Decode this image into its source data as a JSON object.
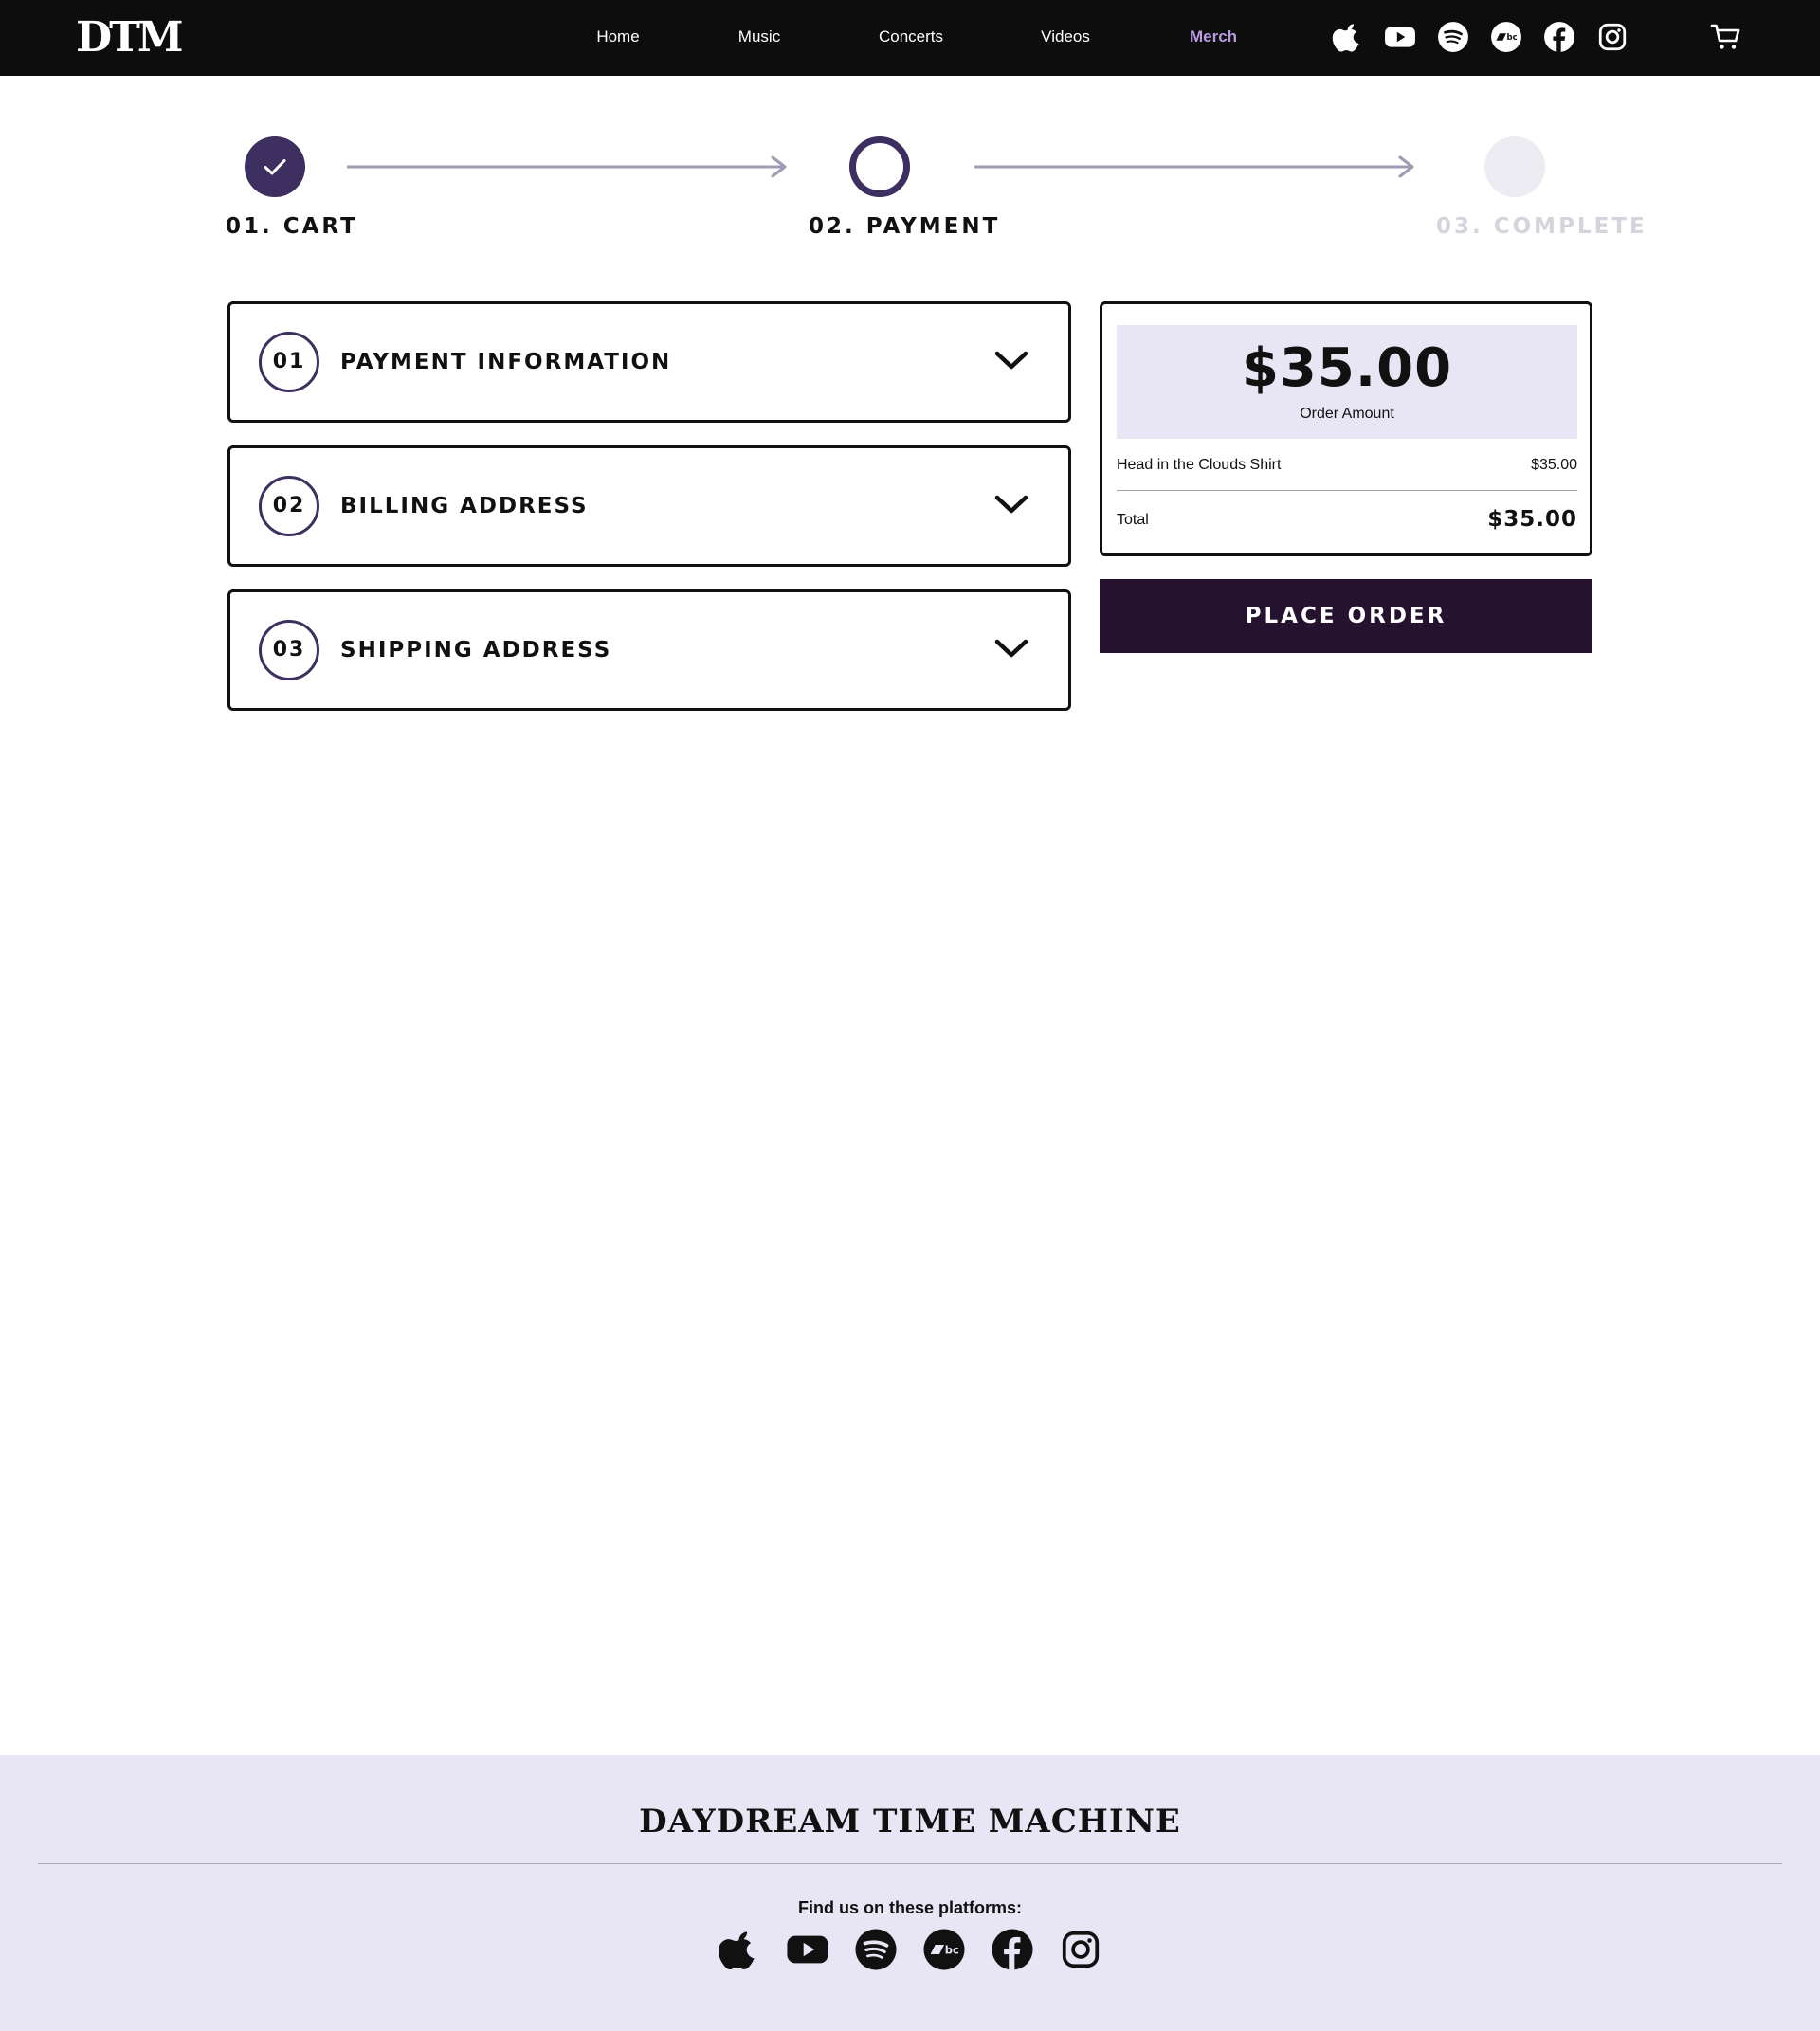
{
  "header": {
    "logo_text": "DTM",
    "nav": [
      {
        "label": "Home"
      },
      {
        "label": "Music"
      },
      {
        "label": "Concerts"
      },
      {
        "label": "Videos"
      },
      {
        "label": "Merch",
        "active": true
      }
    ],
    "social_icons": [
      "apple-music-icon",
      "youtube-icon",
      "spotify-icon",
      "bandcamp-icon",
      "facebook-icon",
      "instagram-icon"
    ],
    "cart_icon": "cart-icon"
  },
  "stepper": {
    "steps": [
      {
        "label": "01. CART",
        "state": "done"
      },
      {
        "label": "02. PAYMENT",
        "state": "current"
      },
      {
        "label": "03. COMPLETE",
        "state": "todo"
      }
    ]
  },
  "sections": [
    {
      "number": "01",
      "title": "PAYMENT INFORMATION"
    },
    {
      "number": "02",
      "title": "BILLING ADDRESS"
    },
    {
      "number": "03",
      "title": "SHIPPING ADDRESS"
    }
  ],
  "summary": {
    "amount": "$35.00",
    "amount_label": "Order Amount",
    "item_name": "Head in the Clouds Shirt",
    "item_price": "$35.00",
    "total_label": "Total",
    "total_value": "$35.00",
    "place_order_label": "PLACE ORDER"
  },
  "footer": {
    "brand": "DAYDREAM TIME MACHINE",
    "find_text": "Find us on these platforms:"
  },
  "colors": {
    "header_bg": "#0d0d0d",
    "nav_active": "#b89be0",
    "accent": "#3d2f5f",
    "button_bg": "#25122e",
    "summary_box": "#e8e5f4",
    "footer_bg": "#e8e5f4"
  }
}
